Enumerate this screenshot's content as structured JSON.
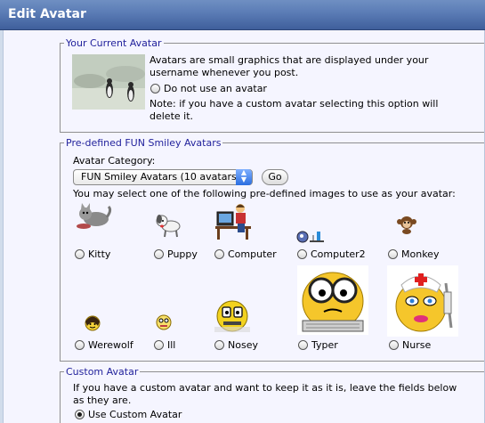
{
  "title": "Edit Avatar",
  "current": {
    "legend": "Your Current Avatar",
    "desc1": "Avatars are small graphics that are displayed under your",
    "desc2": "username whenever you post.",
    "option": "Do not use an avatar",
    "note1": "Note: if you have a custom avatar selecting this option will",
    "note2": "delete it."
  },
  "predef": {
    "legend": "Pre-defined FUN Smiley Avatars",
    "category_label": "Avatar Category:",
    "category_value": "FUN Smiley Avatars (10 avatars)",
    "go_label": "Go",
    "instruction": "You may select one of the following pre-defined images to use as your avatar:",
    "avatars": [
      {
        "label": "Kitty",
        "icon": "kitty-icon"
      },
      {
        "label": "Puppy",
        "icon": "puppy-icon"
      },
      {
        "label": "Computer",
        "icon": "computer-icon"
      },
      {
        "label": "Computer2",
        "icon": "computer2-icon"
      },
      {
        "label": "Monkey",
        "icon": "monkey-icon"
      },
      {
        "label": "Werewolf",
        "icon": "werewolf-icon"
      },
      {
        "label": "Ill",
        "icon": "ill-icon"
      },
      {
        "label": "Nosey",
        "icon": "nosey-icon"
      },
      {
        "label": "Typer",
        "icon": "typer-icon"
      },
      {
        "label": "Nurse",
        "icon": "nurse-icon"
      }
    ]
  },
  "custom": {
    "legend": "Custom Avatar",
    "desc1": "If you have a custom avatar and want to keep it as it is, leave the fields below",
    "desc2": "as they are.",
    "option": "Use Custom Avatar"
  }
}
